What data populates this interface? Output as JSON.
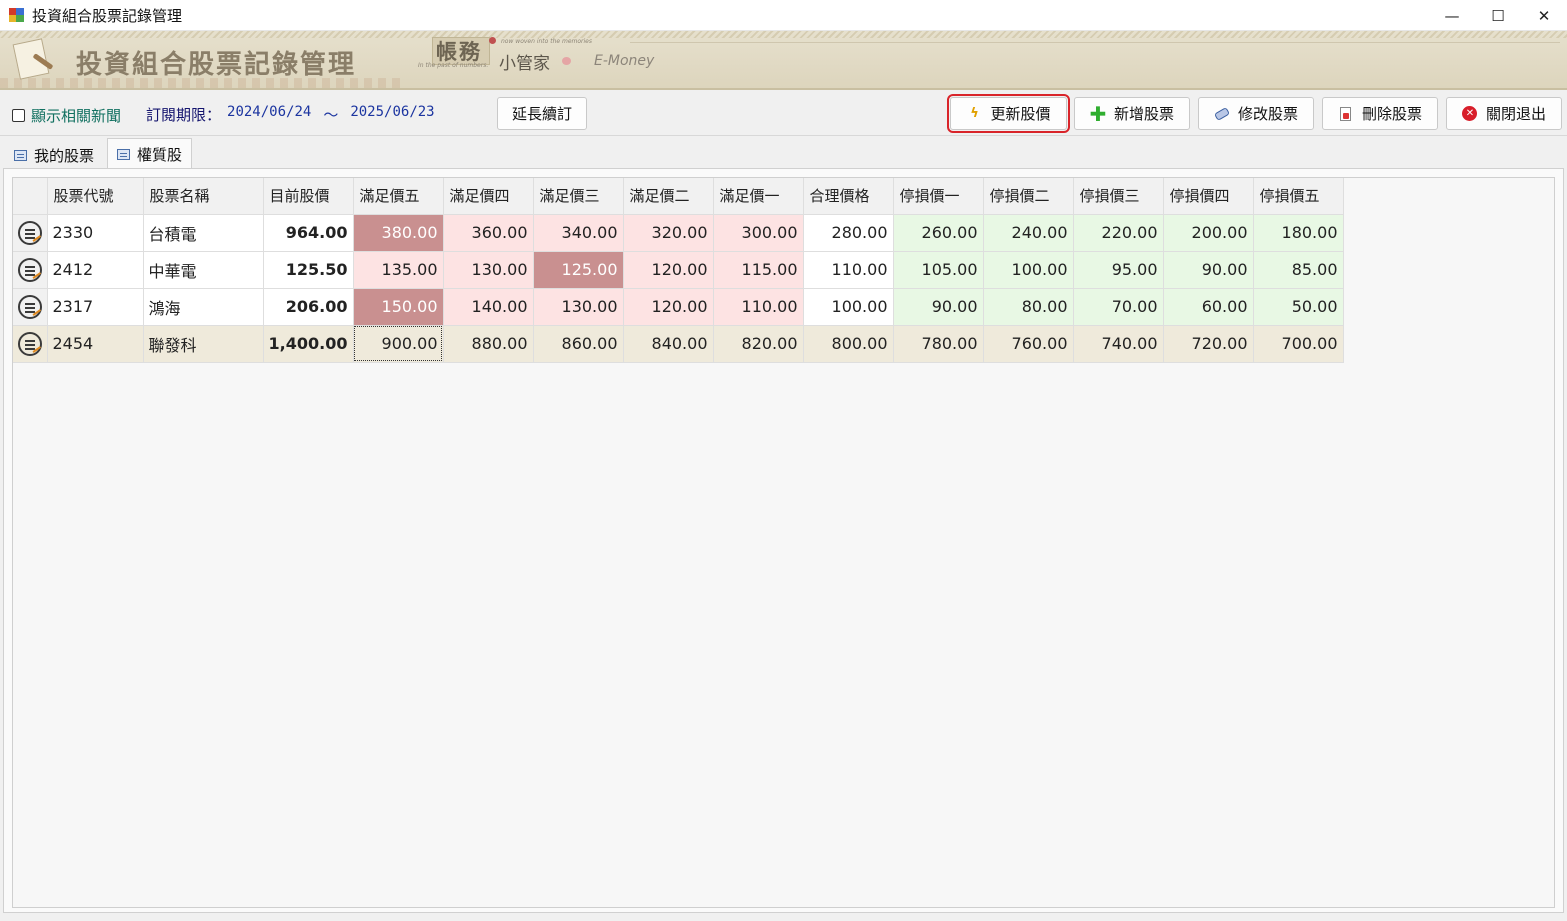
{
  "window": {
    "title": "投資組合股票記錄管理",
    "minimize_glyph": "—",
    "maximize_glyph": "☐",
    "close_glyph": "✕"
  },
  "banner": {
    "title": "投資組合股票記錄管理",
    "brand_main": "帳務",
    "brand_sub": "小管家",
    "brand_en": "E-Money",
    "tagline_top": "now woven into the memories",
    "tagline_bottom": "In the past of numbers."
  },
  "toolbar": {
    "show_news_label": "顯示相關新聞",
    "show_news_checked": false,
    "subscription_label": "訂閱期限：",
    "subscription_start": "2024/06/24",
    "subscription_sep": "～",
    "subscription_end": "2025/06/23",
    "extend_label": "延長續訂",
    "update_label": "更新股價",
    "add_label": "新增股票",
    "edit_label": "修改股票",
    "delete_label": "刪除股票",
    "exit_label": "關閉退出",
    "highlight_color": "#d9242a"
  },
  "tabs": [
    {
      "label": "我的股票",
      "active": false
    },
    {
      "label": "權質股",
      "active": true
    }
  ],
  "grid": {
    "headers": [
      "股票代號",
      "股票名稱",
      "目前股價",
      "滿足價五",
      "滿足價四",
      "滿足價三",
      "滿足價二",
      "滿足價一",
      "合理價格",
      "停損價一",
      "停損價二",
      "停損價三",
      "停損價四",
      "停損價五"
    ],
    "rows": [
      {
        "code": "2330",
        "name": "台積電",
        "price": "964.00",
        "targets": [
          "380.00",
          "360.00",
          "340.00",
          "320.00",
          "300.00",
          "280.00",
          "260.00",
          "240.00",
          "220.00",
          "200.00",
          "180.00"
        ],
        "hit_index": 0
      },
      {
        "code": "2412",
        "name": "中華電",
        "price": "125.50",
        "targets": [
          "135.00",
          "130.00",
          "125.00",
          "120.00",
          "115.00",
          "110.00",
          "105.00",
          "100.00",
          "95.00",
          "90.00",
          "85.00"
        ],
        "hit_index": 2
      },
      {
        "code": "2317",
        "name": "鴻海",
        "price": "206.00",
        "targets": [
          "150.00",
          "140.00",
          "130.00",
          "120.00",
          "110.00",
          "100.00",
          "90.00",
          "80.00",
          "70.00",
          "60.00",
          "50.00"
        ],
        "hit_index": 0
      },
      {
        "code": "2454",
        "name": "聯發科",
        "price": "1,400.00",
        "targets": [
          "900.00",
          "880.00",
          "860.00",
          "840.00",
          "820.00",
          "800.00",
          "780.00",
          "760.00",
          "740.00",
          "720.00",
          "700.00"
        ],
        "hit_index": -1,
        "selected": true
      }
    ],
    "colors": {
      "target_bg": "#fde3e3",
      "target_hit_bg": "#c99090",
      "stoploss_bg": "#e8f8e4",
      "selected_row_bg": "#efeadb"
    }
  }
}
